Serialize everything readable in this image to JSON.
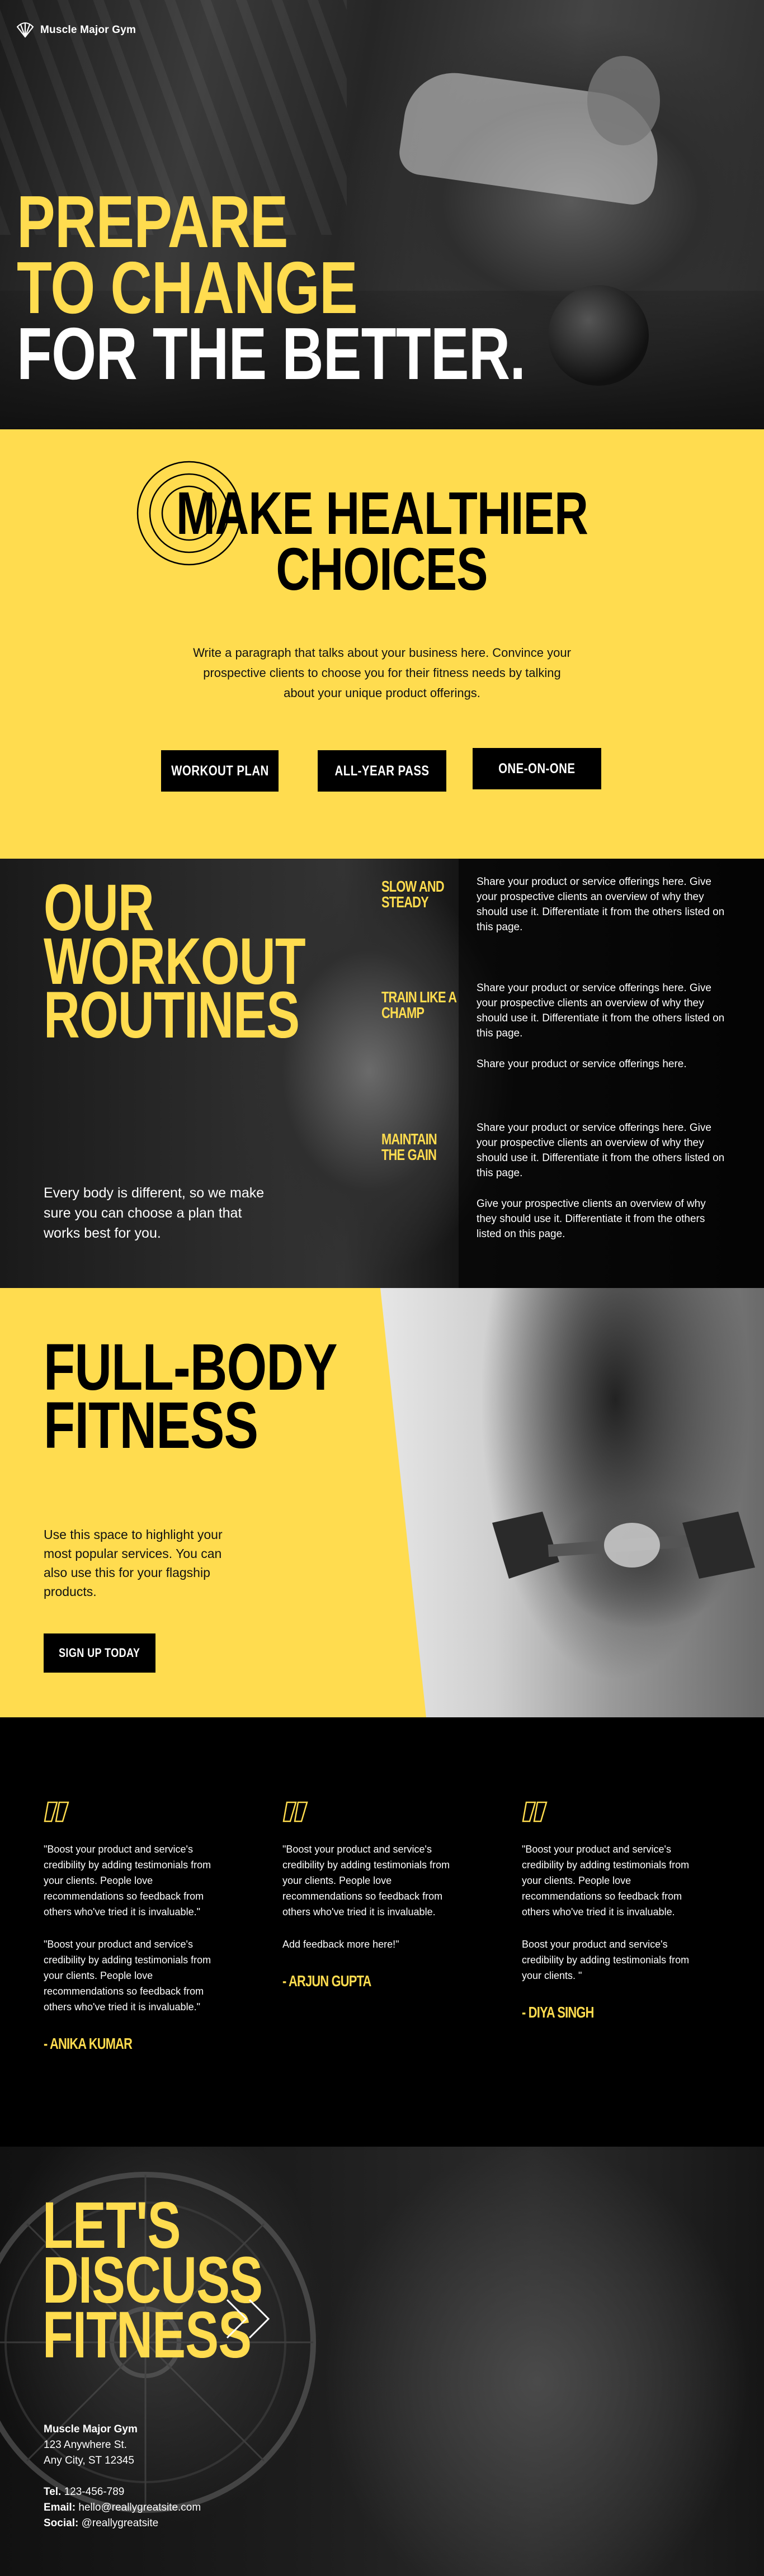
{
  "brand": {
    "name": "Muscle Major Gym"
  },
  "hero": {
    "line1": "PREPARE",
    "line2": "TO CHANGE",
    "line3": "FOR THE BETTER."
  },
  "healthier": {
    "title_line1": "MAKE HEALTHIER",
    "title_line2": "CHOICES",
    "paragraph": "Write a paragraph that talks about your business here. Convince your prospective clients to choose you for their fitness needs by talking about your unique product offerings.",
    "buttons": [
      "WORKOUT PLAN",
      "ALL-YEAR PASS",
      "ONE-ON-ONE"
    ]
  },
  "routines": {
    "title_line1": "OUR",
    "title_line2": "WORKOUT",
    "title_line3": "ROUTINES",
    "subtitle": "Every body is different, so we make sure you can choose a plan that works best for you.",
    "items": [
      {
        "label_line1": "SLOW AND",
        "label_line2": "STEADY",
        "text": "Share your product or service offerings here. Give your prospective clients an overview of why they should use it. Differentiate it from the others listed on this page."
      },
      {
        "label_line1": "TRAIN LIKE A",
        "label_line2": "CHAMP",
        "text": "Share your product or service offerings here. Give your prospective clients an overview of why they should use it. Differentiate it from the others listed on this page."
      },
      {
        "label_line1": "",
        "label_line2": "",
        "text": "Share your product or service offerings here."
      },
      {
        "label_line1": "MAINTAIN",
        "label_line2": "THE GAIN",
        "text": "Share your product or service offerings here. Give your prospective clients an overview of why they should use it. Differentiate it from the others listed on this page."
      },
      {
        "label_line1": "",
        "label_line2": "",
        "text": "Give your prospective clients an overview of why they should use it. Differentiate it from the others listed on this page."
      }
    ]
  },
  "fullbody": {
    "title_line1": "FULL-BODY",
    "title_line2": "FITNESS",
    "text": "Use this space to highlight your most popular services. You can also use this for your flagship products.",
    "button": "SIGN UP TODAY"
  },
  "testimonials": [
    {
      "paragraphs": [
        "\"Boost your product and service's credibility by adding testimonials from your clients. People love recommendations so feedback from others who've tried it is invaluable.\"",
        "\"Boost your product and service's credibility by adding testimonials from your clients. People love recommendations so feedback from others who've tried it is invaluable.\""
      ],
      "author": "- ANIKA KUMAR"
    },
    {
      "paragraphs": [
        "\"Boost your product and service's credibility by adding testimonials from your clients. People love recommendations so feedback from others who've tried it is invaluable.",
        "Add feedback more here!\""
      ],
      "author": "- ARJUN GUPTA"
    },
    {
      "paragraphs": [
        "\"Boost your product and service's credibility by adding testimonials from your clients. People love recommendations so feedback from others who've tried it is invaluable.",
        "Boost your product and service's credibility by adding testimonials from your clients. \""
      ],
      "author": "- DIYA SINGH"
    }
  ],
  "discuss": {
    "title_line1": "LET'S",
    "title_line2": "DISCUSS",
    "title_line3": "FITNESS"
  },
  "contact": {
    "name": "Muscle Major Gym",
    "address_line1": "123 Anywhere St.",
    "address_line2": "Any City, ST 12345",
    "tel_label": "Tel.",
    "tel": "123-456-789",
    "email_label": "Email:",
    "email": "hello@reallygreatsite.com",
    "social_label": "Social:",
    "social": "@reallygreatsite"
  },
  "colors": {
    "accent_yellow": "#ffdc4f",
    "black": "#000000",
    "white": "#ffffff"
  },
  "icons": [
    "shell-logo-icon",
    "concentric-rings-icon",
    "quote-icon",
    "double-chevron-icon"
  ]
}
